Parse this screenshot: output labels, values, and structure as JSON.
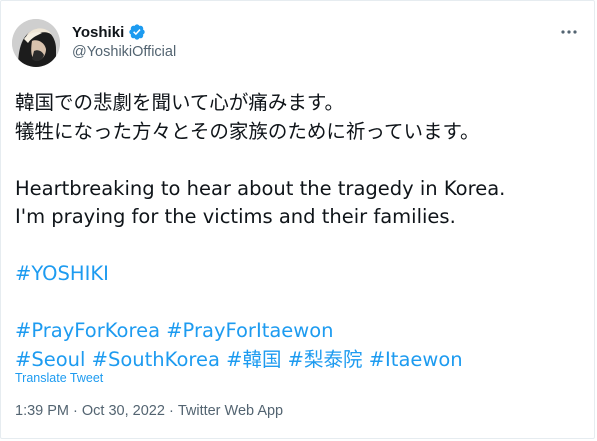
{
  "user": {
    "display_name": "Yoshiki",
    "handle": "@YoshikiOfficial"
  },
  "tweet": {
    "jp_line_1": "韓国での悲劇を聞いて心が痛みます。",
    "jp_line_2": "犠牲になった方々とその家族のために祈っています。",
    "en_line_1": "Heartbreaking to hear about the tragedy in Korea.",
    "en_line_2": "I'm praying for the victims and their families.",
    "hashtags_line_1": [
      "#YOSHIKI"
    ],
    "hashtags_line_2": [
      "#PrayForKorea",
      "#PrayForItaewon"
    ],
    "hashtags_line_3": [
      "#Seoul",
      "#SouthKorea",
      "#韓国",
      "#梨泰院",
      "#Itaewon"
    ]
  },
  "translate_label": "Translate Tweet",
  "meta": {
    "time": "1:39 PM",
    "separator": " · ",
    "date": "Oct 30, 2022",
    "source": "Twitter Web App"
  },
  "colors": {
    "link": "#1d9bf0",
    "text": "#0f1419",
    "secondary": "#536471",
    "verified": "#1d9bf0"
  },
  "icons": {
    "verified": "verified-badge-icon",
    "more": "more-options-icon"
  }
}
